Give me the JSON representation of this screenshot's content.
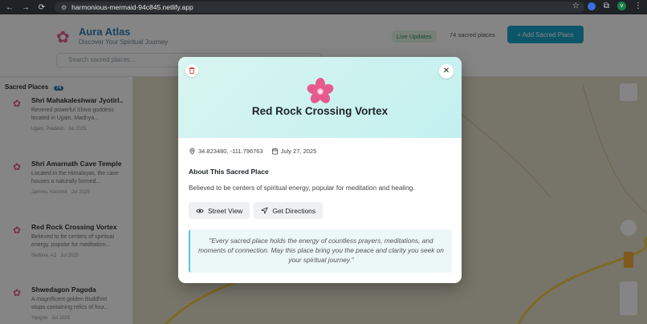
{
  "browser": {
    "url": "harmonious-mermaid-94c845.netlify.app",
    "nav_back": "←",
    "nav_forward": "→",
    "nav_reload": "⟳",
    "profile_initial": "v"
  },
  "app": {
    "title": "Aura Atlas",
    "subtitle": "Discover Your Spiritual Journey",
    "live_label": "Live Updates",
    "count_label": "74 sacred places",
    "add_button": "+ Add Sacred Place",
    "search_placeholder": "Search sacred places...",
    "sidebar_title": "Sacred Places",
    "sidebar_count": "74",
    "places": [
      {
        "name": "Shri Mahakaleshwar Jyotirl...",
        "desc": "Revered powerful Shiva goddess located in Ujjain, Madhya...",
        "meta_a": "Ujjain, Pradesh",
        "meta_b": "Jul 2025"
      },
      {
        "name": "Shri Amarnath Cave Temple",
        "desc": "Located in the Himalayas, the cave houses a naturally formed...",
        "meta_a": "Jammu, Kashmir",
        "meta_b": "Jul 2025"
      },
      {
        "name": "Red Rock Crossing Vortex",
        "desc": "Believed to be centers of spiritual energy, popular for meditation...",
        "meta_a": "Sedona, AZ",
        "meta_b": "Jul 2025"
      },
      {
        "name": "Shwedagon Pagoda",
        "desc": "A magnificent golden Buddhist stupa containing relics of four...",
        "meta_a": "Yangon",
        "meta_b": "Jul 2025"
      }
    ]
  },
  "modal": {
    "title": "Red Rock Crossing Vortex",
    "coordinates": "34.823480, -111.796763",
    "date": "July 27, 2025",
    "about_heading": "About This Sacred Place",
    "about_text": "Believed to be centers of spiritual energy, popular for meditation and healing.",
    "street_view_label": "Street View",
    "directions_label": "Get Directions",
    "quote": "\"Every sacred place holds the energy of countless prayers, meditations, and moments of connection. May this place bring you the peace and clarity you seek on your spiritual journey.\"",
    "close_glyph": "✕",
    "accent_color": "#e85a8f",
    "hero_color": "#c2f0ef"
  }
}
